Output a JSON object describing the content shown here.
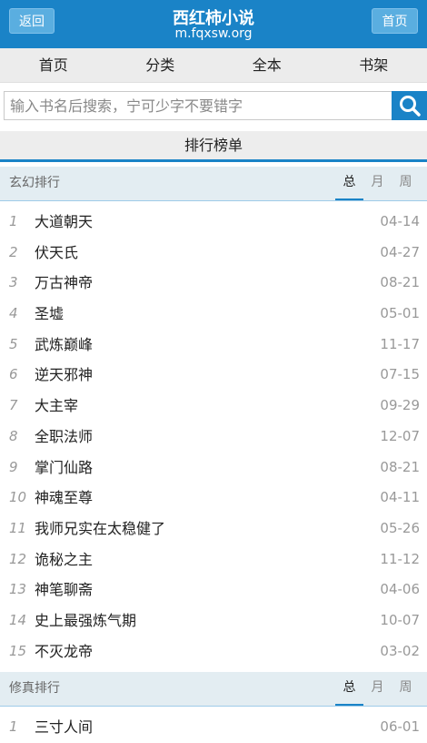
{
  "header": {
    "back_label": "返回",
    "site_title": "西红柿小说",
    "site_domain": "m.fqxsw.org",
    "home_label": "首页"
  },
  "nav": [
    "首页",
    "分类",
    "全本",
    "书架"
  ],
  "search": {
    "placeholder": "输入书名后搜索，宁可少字不要错字",
    "icon": "search-icon"
  },
  "rank_title": "排行榜单",
  "sections": [
    {
      "title": "玄幻排行",
      "tabs": [
        "总",
        "月",
        "周"
      ],
      "active_tab": "总",
      "items": [
        {
          "num": "1",
          "name": "大道朝天",
          "date": "04-14"
        },
        {
          "num": "2",
          "name": "伏天氏",
          "date": "04-27"
        },
        {
          "num": "3",
          "name": "万古神帝",
          "date": "08-21"
        },
        {
          "num": "4",
          "name": "圣墟",
          "date": "05-01"
        },
        {
          "num": "5",
          "name": "武炼巅峰",
          "date": "11-17"
        },
        {
          "num": "6",
          "name": "逆天邪神",
          "date": "07-15"
        },
        {
          "num": "7",
          "name": "大主宰",
          "date": "09-29"
        },
        {
          "num": "8",
          "name": "全职法师",
          "date": "12-07"
        },
        {
          "num": "9",
          "name": "掌门仙路",
          "date": "08-21"
        },
        {
          "num": "10",
          "name": "神魂至尊",
          "date": "04-11"
        },
        {
          "num": "11",
          "name": "我师兄实在太稳健了",
          "date": "05-26"
        },
        {
          "num": "12",
          "name": "诡秘之主",
          "date": "11-12"
        },
        {
          "num": "13",
          "name": "神笔聊斋",
          "date": "04-06"
        },
        {
          "num": "14",
          "name": "史上最强炼气期",
          "date": "10-07"
        },
        {
          "num": "15",
          "name": "不灭龙帝",
          "date": "03-02"
        }
      ]
    },
    {
      "title": "修真排行",
      "tabs": [
        "总",
        "月",
        "周"
      ],
      "active_tab": "总",
      "items": [
        {
          "num": "1",
          "name": "三寸人间",
          "date": "06-01"
        }
      ]
    }
  ],
  "colors": {
    "brand_blue": "#1a83c7",
    "section_bg": "#e3edf2",
    "nav_bg": "#ececec"
  }
}
